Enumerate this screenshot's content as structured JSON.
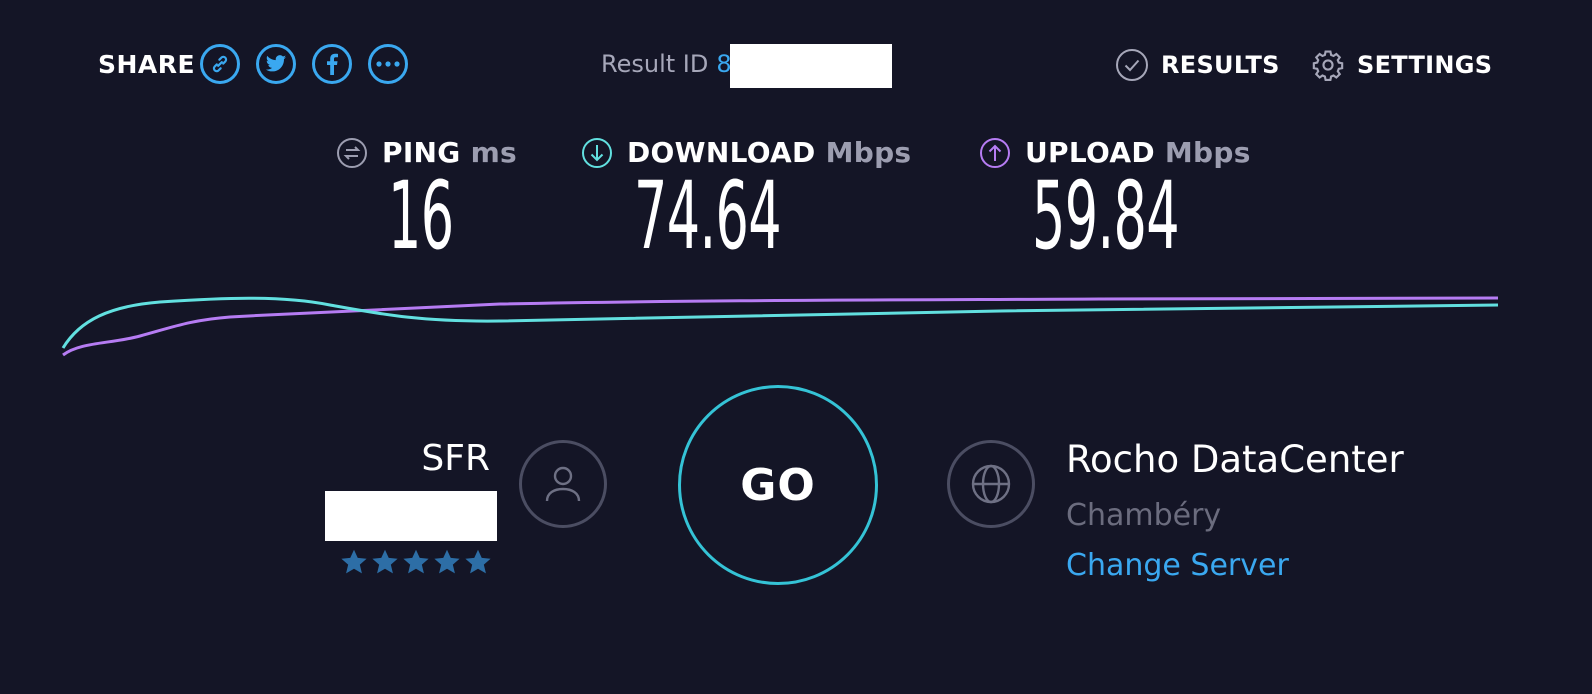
{
  "header": {
    "share_label": "SHARE",
    "share_buttons": [
      {
        "icon": "link-icon"
      },
      {
        "icon": "twitter-icon"
      },
      {
        "icon": "facebook-icon"
      },
      {
        "icon": "more-icon"
      }
    ],
    "result_id_label": "Result ID",
    "result_id_value": "8",
    "results_label": "RESULTS",
    "settings_label": "SETTINGS"
  },
  "metrics": {
    "ping": {
      "label": "PING",
      "unit": "ms",
      "value": "16",
      "icon": "ping-icon",
      "color": "#9c9db0"
    },
    "download": {
      "label": "DOWNLOAD",
      "unit": "Mbps",
      "value": "74.64",
      "icon": "download-icon",
      "color": "#62e0e0"
    },
    "upload": {
      "label": "UPLOAD",
      "unit": "Mbps",
      "value": "59.84",
      "icon": "upload-icon",
      "color": "#b67cf3"
    }
  },
  "isp": {
    "name": "SFR",
    "rating": 5,
    "rating_max": 5,
    "icon": "user-icon"
  },
  "go_button": {
    "label": "GO"
  },
  "server": {
    "name": "Rocho DataCenter",
    "location": "Chambéry",
    "change_label": "Change Server",
    "icon": "globe-icon"
  },
  "colors": {
    "background": "#141526",
    "accent_blue": "#3aa8f0",
    "download_line": "#62e0e0",
    "upload_line": "#b67cf3",
    "star": "#2d6ea6"
  }
}
